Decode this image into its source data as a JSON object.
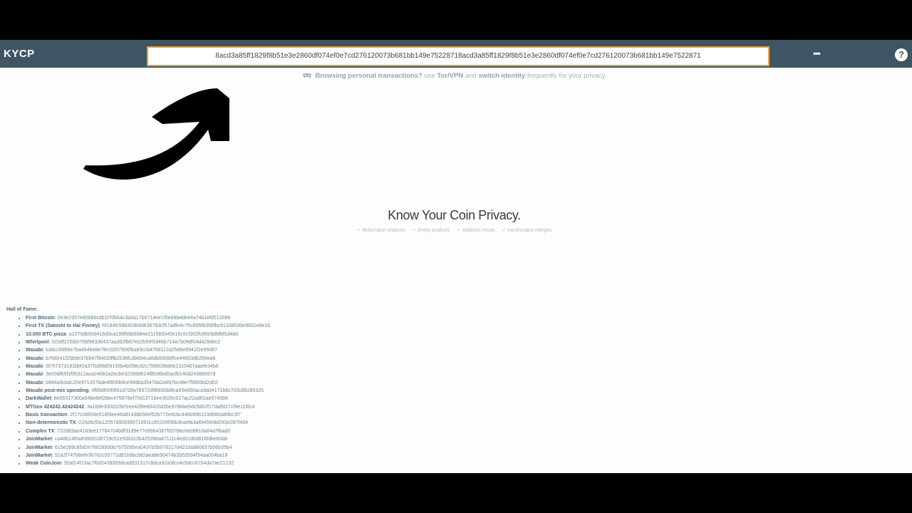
{
  "app": {
    "brand": "KYCP"
  },
  "search": {
    "value": "8acd3a85ff1829f8b51e3e2860df074ef0e7cd276120073b681bb149e75228718acd3a85ff1829f8b51e3e2860df074ef0e7cd276120073b681bb149e7522871"
  },
  "navbar": {
    "menu_dots": "•••",
    "help_label": "?"
  },
  "privacy_note": {
    "strong1": "Browsing personal transactions?",
    "text1": "use",
    "strong2": "Tor/VPN",
    "text2": "and",
    "strong3": "switch identity",
    "text3": "frequently for your privacy"
  },
  "hero": {
    "title": "Know Your Coin Privacy.",
    "features": [
      "Boltzmann analysis",
      "Entity analysis",
      "Address reuse",
      "Input/output merges"
    ]
  },
  "hall_of_fame": {
    "title": "Hall of Fame:",
    "items": [
      {
        "label": "First Bitcoin",
        "txid": "0e3e2357e806b6cdb1f70b54c3a3a17b6714ee1f0e68bebb44a74b1efd512098"
      },
      {
        "label": "First TX (Satoshi to Hal Finney)",
        "txid": "f4184fc596403b9d638783cf57adfe4c75c605f6356fbc91338530e9831e9e16"
      },
      {
        "label": "10.000 BTC pizza",
        "txid": "a1075db55d416d3ca199f55b6084e2115b9345e16c5cf302fc80e9d5fbf5d48d"
      },
      {
        "label": "Whirlpool",
        "txid": "323df21f0b0756f98336437aa3d2fb87e02b59f1946b714a7b09df04d429dec2"
      },
      {
        "label": "Wasabi",
        "txid": "b3dcc5d68e7ba4946e8e7fec0207906fba89ccb4768112a25d6e6941f2e99d97"
      },
      {
        "label": "Wasabi",
        "txid": "b768041f25b9e37b547f84029fb2536fc3b694ca8db59088fce44903db269ea6"
      },
      {
        "label": "Wasabi",
        "txid": "6f757373191bbf2a375d99d09150b4b098cd2c7586036deb1310467aaefe34b6"
      },
      {
        "label": "Wasabi",
        "txid": "3e00df65f1f95312aca24082a2ecbe32289d624f8536bd0acfb140d24388087d"
      },
      {
        "label": "Wasabi",
        "txid": "b994a9cbdc20e971207bde4f800b9ce99dba35478a2a997bc48e7f9f80bd2d02"
      },
      {
        "label": "Wasabi post-mix spending",
        "txid": "4f89d6599fd1d728a78972d96930b8fca55e060aca9a04171b6c703c88285325"
      },
      {
        "label": "DarkWallet",
        "txid": "8e56317360a548e8ef28ec475878ef70d1371bee3526c017ac22ad61ae5740b8"
      },
      {
        "label": "MTGox 424242.42424242",
        "txid": "3a1b9e330d32fef1ee42f8e86420d2be978bbe0dc5862f17da9027cf9e11f8c4"
      },
      {
        "label": "Basic transaction",
        "txid": "2f17c08654e518f3ee46dd1438b58ef52b772e8cbc446b96b123d680a80bc3f7"
      },
      {
        "label": "Non-deterministic TX",
        "txid": "015d9cf0a12057d009395710611c65109f36b3eaefa3a694594bf243c097f404"
      },
      {
        "label": "Complex TX",
        "txid": "722d83ae4183ee17784704bdf31d9e77e6964387f657bbc0e09810a84a7fbad2"
      },
      {
        "label": "JoinMarket",
        "txid": "ca48b14f0a836b91d8719c51e50b313b425356a87111c4ed2cd6d81f0dbe60de"
      },
      {
        "label": "JoinMarket",
        "txid": "615e269c85d2e78828930b7675095ea0437b5b976217d4210a980d37b56b35b4"
      },
      {
        "label": "JoinMarket",
        "txid": "51a2f747b6efe36762c05771d9168bc9d2aea8e90474b2b53594f34aa054ba18"
      },
      {
        "label": "Weak CoinJoin",
        "txid": "92af14f15ac7f0d2439359dcad931317c8dca92a3fcc4e5dcc6704da7ae21232"
      }
    ]
  },
  "colors": {
    "navbar": "#3f5563",
    "search_border": "#f0a030",
    "background": "#fdfdfd"
  }
}
